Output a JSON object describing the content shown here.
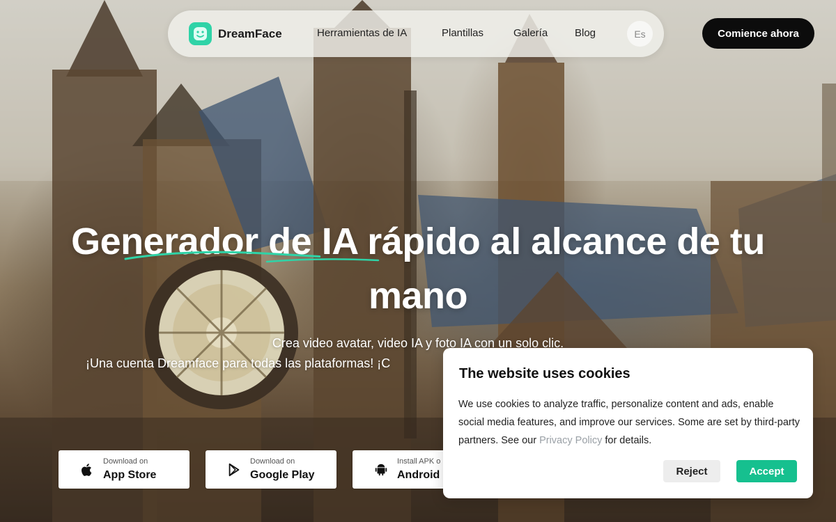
{
  "nav": {
    "brand": "DreamFace",
    "links": [
      "Herramientas de IA",
      "Plantillas",
      "Galería",
      "Blog"
    ],
    "language": "Es",
    "cta": "Comience ahora"
  },
  "hero": {
    "title_line1": "Generador de IA rápido al alcance de tu",
    "title_line2": "mano",
    "subtitle_line1": "Crea video avatar, video IA y foto IA con un solo clic.",
    "subtitle_line2": "¡Una cuenta Dreamface para todas las plataformas! ¡C"
  },
  "downloads": [
    {
      "small": "Download on",
      "label": "App Store",
      "icon": "apple-icon"
    },
    {
      "small": "Download on",
      "label": "Google Play",
      "icon": "play-icon"
    },
    {
      "small": "Install APK o",
      "label": "Android",
      "icon": "android-icon"
    }
  ],
  "cookie": {
    "title": "The website uses cookies",
    "text_before_link": "We use cookies to analyze traffic, personalize content and ads, enable social media features, and improve our services. Some are set by third-party partners. See our ",
    "link": "Privacy Policy",
    "text_after_link": " for details.",
    "reject": "Reject",
    "accept": "Accept"
  },
  "colors": {
    "brand": "#2fd3a7",
    "accept": "#16c08f",
    "cta_bg": "#0c0c0c"
  }
}
